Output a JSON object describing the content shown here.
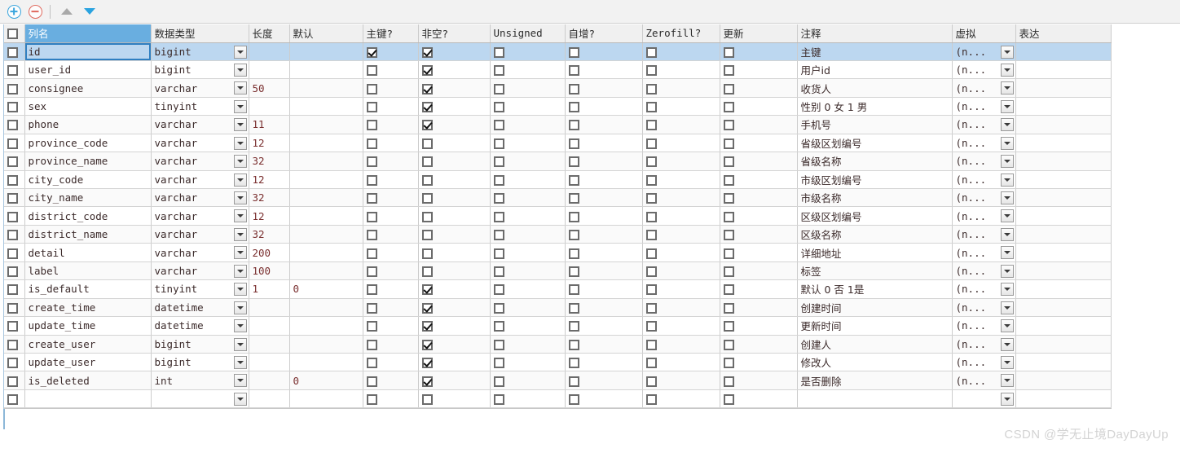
{
  "toolbar": {
    "add_label": "+",
    "remove_label": "−",
    "move_up_label": "▲",
    "move_down_label": "▼"
  },
  "grid": {
    "headers": [
      "",
      "列名",
      "数据类型",
      "长度",
      "默认",
      "主键?",
      "非空?",
      "Unsigned",
      "自增?",
      "Zerofill?",
      "更新",
      "注释",
      "虚拟",
      "表达"
    ],
    "virtual_placeholder": "(n...",
    "rows": [
      {
        "name": "id",
        "type": "bigint",
        "length": "",
        "default": "",
        "pk": true,
        "notnull": true,
        "unsigned": false,
        "autoinc": false,
        "zerofill": false,
        "update": false,
        "comment": "主键",
        "virtual": "(n...",
        "expression": ""
      },
      {
        "name": "user_id",
        "type": "bigint",
        "length": "",
        "default": "",
        "pk": false,
        "notnull": true,
        "unsigned": false,
        "autoinc": false,
        "zerofill": false,
        "update": false,
        "comment": "用户id",
        "virtual": "(n...",
        "expression": ""
      },
      {
        "name": "consignee",
        "type": "varchar",
        "length": "50",
        "default": "",
        "pk": false,
        "notnull": true,
        "unsigned": false,
        "autoinc": false,
        "zerofill": false,
        "update": false,
        "comment": "收货人",
        "virtual": "(n...",
        "expression": ""
      },
      {
        "name": "sex",
        "type": "tinyint",
        "length": "",
        "default": "",
        "pk": false,
        "notnull": true,
        "unsigned": false,
        "autoinc": false,
        "zerofill": false,
        "update": false,
        "comment": "性别 0 女 1 男",
        "virtual": "(n...",
        "expression": ""
      },
      {
        "name": "phone",
        "type": "varchar",
        "length": "11",
        "default": "",
        "pk": false,
        "notnull": true,
        "unsigned": false,
        "autoinc": false,
        "zerofill": false,
        "update": false,
        "comment": "手机号",
        "virtual": "(n...",
        "expression": ""
      },
      {
        "name": "province_code",
        "type": "varchar",
        "length": "12",
        "default": "",
        "pk": false,
        "notnull": false,
        "unsigned": false,
        "autoinc": false,
        "zerofill": false,
        "update": false,
        "comment": "省级区划编号",
        "virtual": "(n...",
        "expression": ""
      },
      {
        "name": "province_name",
        "type": "varchar",
        "length": "32",
        "default": "",
        "pk": false,
        "notnull": false,
        "unsigned": false,
        "autoinc": false,
        "zerofill": false,
        "update": false,
        "comment": "省级名称",
        "virtual": "(n...",
        "expression": ""
      },
      {
        "name": "city_code",
        "type": "varchar",
        "length": "12",
        "default": "",
        "pk": false,
        "notnull": false,
        "unsigned": false,
        "autoinc": false,
        "zerofill": false,
        "update": false,
        "comment": "市级区划编号",
        "virtual": "(n...",
        "expression": ""
      },
      {
        "name": "city_name",
        "type": "varchar",
        "length": "32",
        "default": "",
        "pk": false,
        "notnull": false,
        "unsigned": false,
        "autoinc": false,
        "zerofill": false,
        "update": false,
        "comment": "市级名称",
        "virtual": "(n...",
        "expression": ""
      },
      {
        "name": "district_code",
        "type": "varchar",
        "length": "12",
        "default": "",
        "pk": false,
        "notnull": false,
        "unsigned": false,
        "autoinc": false,
        "zerofill": false,
        "update": false,
        "comment": "区级区划编号",
        "virtual": "(n...",
        "expression": ""
      },
      {
        "name": "district_name",
        "type": "varchar",
        "length": "32",
        "default": "",
        "pk": false,
        "notnull": false,
        "unsigned": false,
        "autoinc": false,
        "zerofill": false,
        "update": false,
        "comment": "区级名称",
        "virtual": "(n...",
        "expression": ""
      },
      {
        "name": "detail",
        "type": "varchar",
        "length": "200",
        "default": "",
        "pk": false,
        "notnull": false,
        "unsigned": false,
        "autoinc": false,
        "zerofill": false,
        "update": false,
        "comment": "详细地址",
        "virtual": "(n...",
        "expression": ""
      },
      {
        "name": "label",
        "type": "varchar",
        "length": "100",
        "default": "",
        "pk": false,
        "notnull": false,
        "unsigned": false,
        "autoinc": false,
        "zerofill": false,
        "update": false,
        "comment": "标签",
        "virtual": "(n...",
        "expression": ""
      },
      {
        "name": "is_default",
        "type": "tinyint",
        "length": "1",
        "default": "0",
        "pk": false,
        "notnull": true,
        "unsigned": false,
        "autoinc": false,
        "zerofill": false,
        "update": false,
        "comment": "默认 0 否 1是",
        "virtual": "(n...",
        "expression": ""
      },
      {
        "name": "create_time",
        "type": "datetime",
        "length": "",
        "default": "",
        "pk": false,
        "notnull": true,
        "unsigned": false,
        "autoinc": false,
        "zerofill": false,
        "update": false,
        "comment": "创建时间",
        "virtual": "(n...",
        "expression": ""
      },
      {
        "name": "update_time",
        "type": "datetime",
        "length": "",
        "default": "",
        "pk": false,
        "notnull": true,
        "unsigned": false,
        "autoinc": false,
        "zerofill": false,
        "update": false,
        "comment": "更新时间",
        "virtual": "(n...",
        "expression": ""
      },
      {
        "name": "create_user",
        "type": "bigint",
        "length": "",
        "default": "",
        "pk": false,
        "notnull": true,
        "unsigned": false,
        "autoinc": false,
        "zerofill": false,
        "update": false,
        "comment": "创建人",
        "virtual": "(n...",
        "expression": ""
      },
      {
        "name": "update_user",
        "type": "bigint",
        "length": "",
        "default": "",
        "pk": false,
        "notnull": true,
        "unsigned": false,
        "autoinc": false,
        "zerofill": false,
        "update": false,
        "comment": "修改人",
        "virtual": "(n...",
        "expression": ""
      },
      {
        "name": "is_deleted",
        "type": "int",
        "length": "",
        "default": "0",
        "pk": false,
        "notnull": true,
        "unsigned": false,
        "autoinc": false,
        "zerofill": false,
        "update": false,
        "comment": "是否删除",
        "virtual": "(n...",
        "expression": ""
      },
      {
        "name": "",
        "type": "",
        "length": "",
        "default": "",
        "pk": false,
        "notnull": false,
        "unsigned": false,
        "autoinc": false,
        "zerofill": false,
        "update": false,
        "comment": "",
        "virtual": "",
        "expression": ""
      }
    ]
  },
  "watermark": "CSDN @学无止境DayDayUp",
  "colors": {
    "header_selected": "#69aee0",
    "row_selected": "#bcd7f0",
    "accent_blue": "#2aa3e0",
    "accent_red": "#e06a5e"
  }
}
